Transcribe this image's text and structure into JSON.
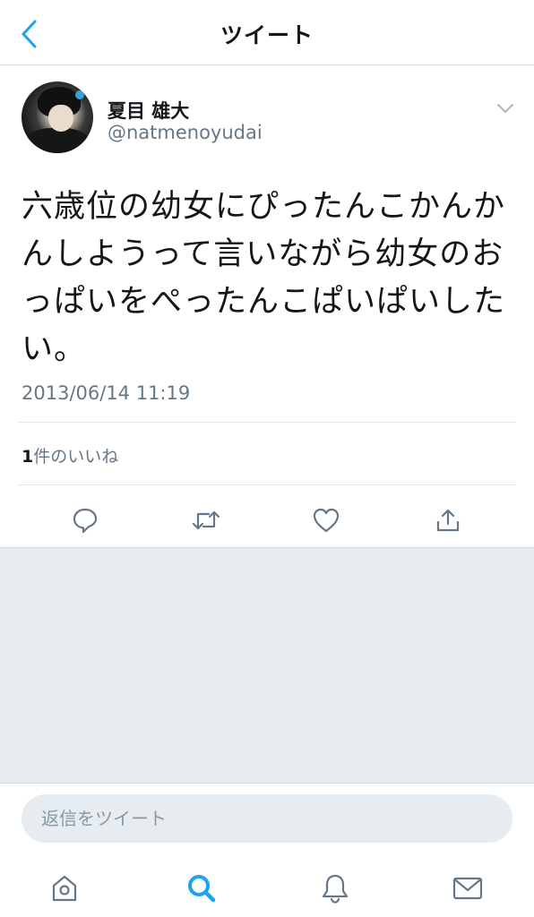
{
  "header": {
    "title": "ツイート"
  },
  "tweet": {
    "display_name": "夏目 雄大",
    "handle": "@natmenoyudai",
    "text": "六歳位の幼女にぴったんこかんかんしようって言いながら幼女のおっぱいをぺったんこぱいぱいしたい。",
    "timestamp": "2013/06/14 11:19",
    "likes_count": "1",
    "likes_label": "件のいいね"
  },
  "reply": {
    "placeholder": "返信をツイート"
  },
  "colors": {
    "accent": "#1da1f2",
    "icon_gray": "#657786",
    "background_gray": "#e6ecf0"
  },
  "icons": {
    "back": "chevron-left-icon",
    "caret": "chevron-down-icon",
    "reply": "reply-icon",
    "retweet": "retweet-icon",
    "like": "heart-icon",
    "share": "share-icon",
    "home": "home-icon",
    "search": "search-icon",
    "notifications": "bell-icon",
    "messages": "mail-icon"
  }
}
